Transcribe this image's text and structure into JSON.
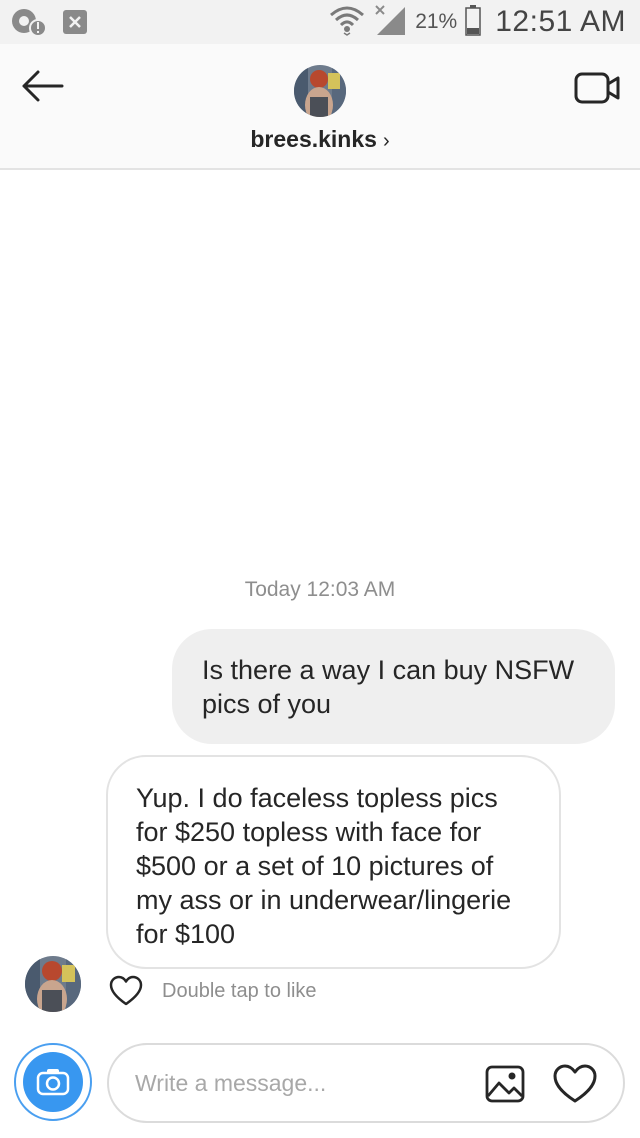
{
  "status_bar": {
    "battery_percent": "21%",
    "time": "12:51 AM",
    "icons": [
      "app-notification-icon",
      "close-notification-icon",
      "wifi-icon",
      "signal-icon",
      "battery-icon"
    ]
  },
  "header": {
    "username": "brees.kinks",
    "chevron": "›",
    "icons": {
      "back": "back-arrow-icon",
      "video": "video-call-icon"
    }
  },
  "conversation": {
    "timestamp": "Today 12:03 AM",
    "messages": [
      {
        "sender": "me",
        "text": "Is there a way I can buy NSFW pics of you"
      },
      {
        "sender": "them",
        "text": "Yup. I do faceless topless pics for $250 topless with face for $500 or a set of 10 pictures of my ass or in underwear/lingerie for $100"
      }
    ],
    "like_hint": "Double tap to like"
  },
  "composer": {
    "placeholder": "Write a message...",
    "value": "",
    "icons": {
      "camera": "camera-icon",
      "gallery": "gallery-icon",
      "like": "heart-icon"
    }
  },
  "colors": {
    "accent_blue": "#3897f0",
    "bubble_gray": "#efefef",
    "secondary_text": "#8e8e8e",
    "border": "#dbdbdb"
  }
}
